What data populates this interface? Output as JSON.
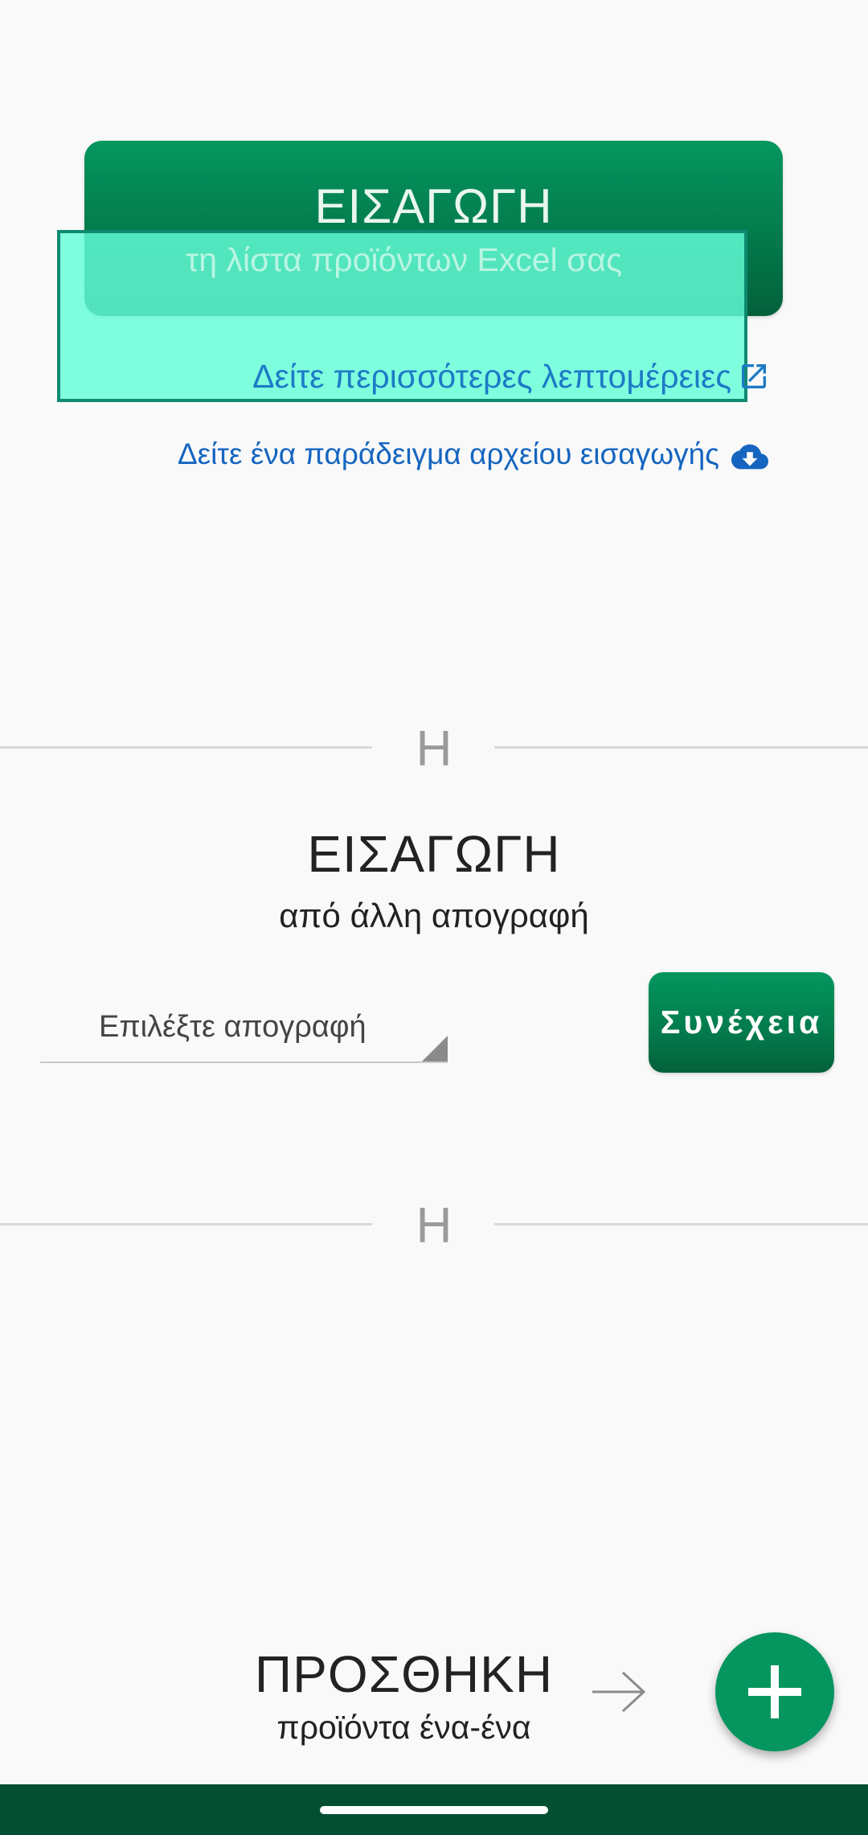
{
  "excel_import": {
    "title": "ΕΙΣΑΓΩΓΗ",
    "subtitle": "τη λίστα προϊόντων Excel σας",
    "more_details_link": "Δείτε περισσότερες λεπτομέρειες",
    "sample_file_link": "Δείτε ένα παράδειγμα αρχείου εισαγωγής"
  },
  "divider_label": "Η",
  "inventory_import": {
    "title": "ΕΙΣΑΓΩΓΗ",
    "subtitle": "από άλλη απογραφή",
    "select_placeholder": "Επιλέξτε απογραφή",
    "continue_label": "Συνέχεια"
  },
  "add_manually": {
    "title": "ΠΡΟΣΘΗΚΗ",
    "subtitle": "προϊόντα ένα-ένα"
  },
  "icons": {
    "external_link": "external-link-icon",
    "download": "cloud-download-icon",
    "arrow": "arrow-right-icon",
    "add": "plus-icon"
  },
  "colors": {
    "primary_green": "#05955f",
    "dark_green": "#034f32",
    "link_blue": "#1565c0",
    "highlight": "#64ffd8"
  }
}
